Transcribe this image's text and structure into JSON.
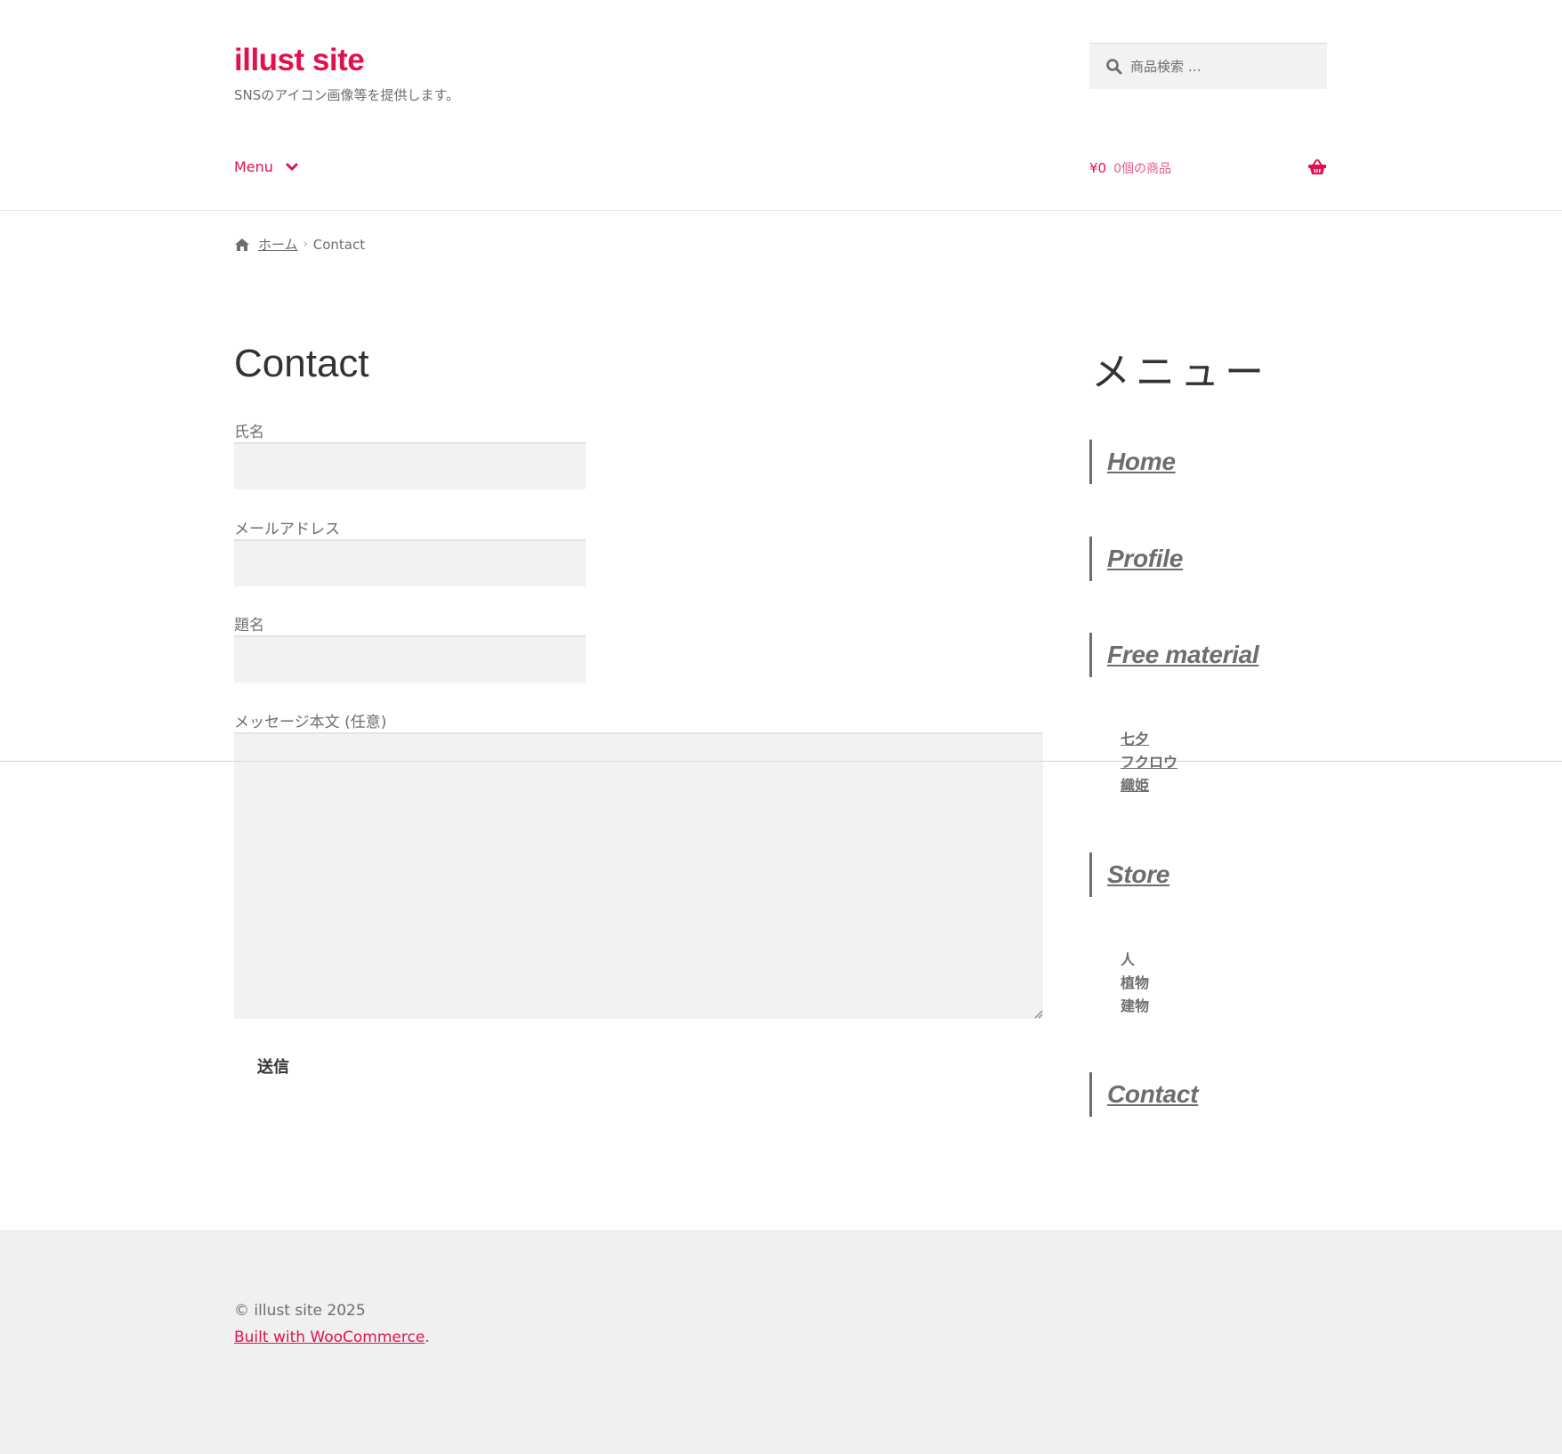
{
  "site": {
    "title": "illust site",
    "tagline": "SNSのアイコン画像等を提供します。"
  },
  "search": {
    "placeholder": "商品検索 …"
  },
  "nav": {
    "menu_label": "Menu"
  },
  "cart": {
    "amount": "¥0",
    "items": "0個の商品"
  },
  "breadcrumb": {
    "home": "ホーム",
    "current": "Contact"
  },
  "page": {
    "title": "Contact",
    "form": {
      "name_label": "氏名",
      "email_label": "メールアドレス",
      "subject_label": "題名",
      "message_label": "メッセージ本文 (任意)",
      "name_value": "",
      "email_value": "",
      "subject_value": "",
      "message_value": "",
      "submit_label": "送信"
    }
  },
  "sidebar": {
    "title": "メニュー",
    "items": [
      {
        "label": "Home"
      },
      {
        "label": "Profile"
      },
      {
        "label": "Free material",
        "children": [
          "七夕",
          "フクロウ",
          "織姫"
        ]
      },
      {
        "label": "Store",
        "children": [
          "人",
          "植物",
          "建物"
        ]
      },
      {
        "label": "Contact"
      }
    ]
  },
  "footer": {
    "copyright": "© illust site 2025",
    "built_link": "Built with WooCommerce",
    "built_suffix": "."
  },
  "colors": {
    "accent": "#e2114c",
    "text": "#6d6d6d",
    "field_bg": "#f2f2f2",
    "footer_bg": "#f0f0f0"
  }
}
